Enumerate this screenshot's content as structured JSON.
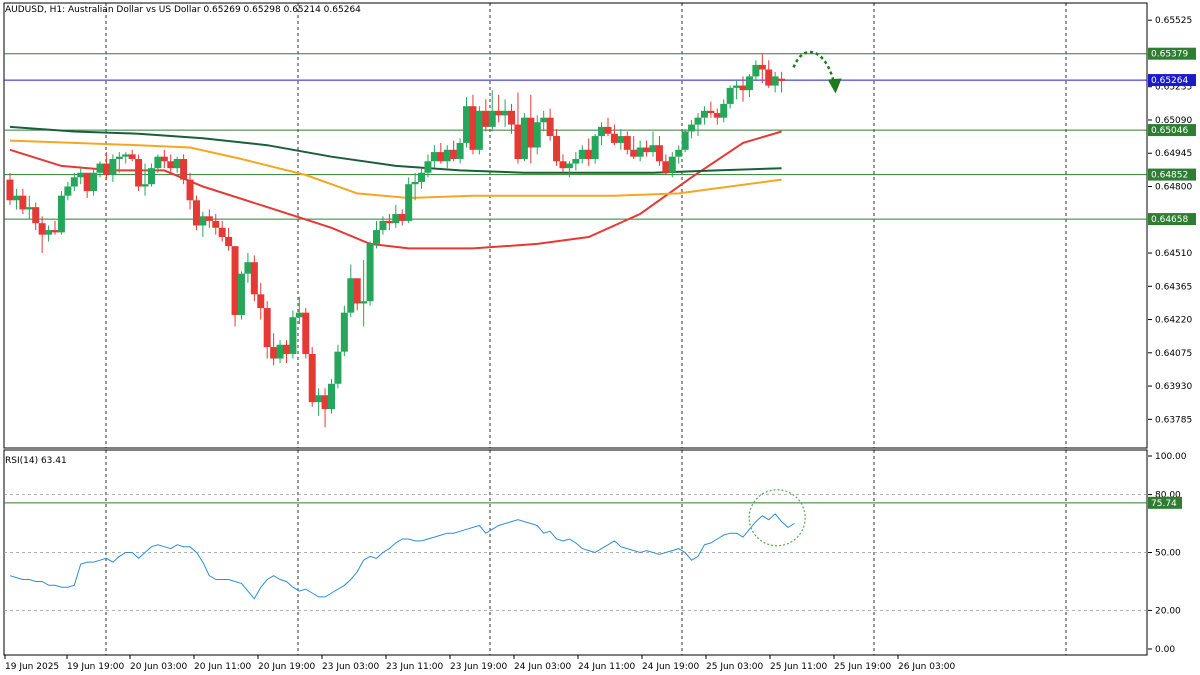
{
  "header": {
    "symbol_line": "AUDUSD, H1:  Australian Dollar vs US Dollar  0.65269 0.65298 0.65214 0.65264"
  },
  "colors": {
    "bull": "#26a65b",
    "bear": "#e53935",
    "ema_fast": "#e53935",
    "ema_mid": "#f5a623",
    "ema_slow": "#1b5e3b",
    "level_line": "#2e7d32",
    "price_line": "#1a1acc",
    "rsi_line": "#2f8fd6",
    "arrow": "#1e7a1e"
  },
  "chart_data": [
    {
      "type": "candlestick",
      "symbol": "AUDUSD",
      "timeframe": "H1",
      "title": "AUDUSD, H1:  Australian Dollar vs US Dollar",
      "last_ohlc": {
        "open": 0.65269,
        "high": 0.65298,
        "low": 0.65214,
        "close": 0.65264
      },
      "ylim": [
        0.6366,
        0.656
      ],
      "y_ticks": [
        "0.65525",
        "0.65235",
        "0.65090",
        "0.64945",
        "0.64800",
        "0.64510",
        "0.64365",
        "0.64220",
        "0.64075",
        "0.63930",
        "0.63785"
      ],
      "x_ticks": [
        "19 Jun 2025",
        "19 Jun 19:00",
        "20 Jun 03:00",
        "20 Jun 11:00",
        "20 Jun 19:00",
        "23 Jun 03:00",
        "23 Jun 11:00",
        "23 Jun 19:00",
        "24 Jun 03:00",
        "24 Jun 11:00",
        "24 Jun 19:00",
        "25 Jun 03:00",
        "25 Jun 11:00",
        "25 Jun 19:00",
        "26 Jun 03:00"
      ],
      "candles": [
        [
          0.6483,
          0.6486,
          0.6472,
          0.6474
        ],
        [
          0.6474,
          0.6479,
          0.647,
          0.6476
        ],
        [
          0.6476,
          0.6479,
          0.6468,
          0.647
        ],
        [
          0.647,
          0.6476,
          0.6466,
          0.6471
        ],
        [
          0.6471,
          0.6473,
          0.6461,
          0.6464
        ],
        [
          0.6464,
          0.6467,
          0.6451,
          0.6459
        ],
        [
          0.6459,
          0.6463,
          0.6456,
          0.6461
        ],
        [
          0.6461,
          0.6465,
          0.6459,
          0.646
        ],
        [
          0.646,
          0.6478,
          0.6459,
          0.6476
        ],
        [
          0.6476,
          0.6482,
          0.6474,
          0.648
        ],
        [
          0.648,
          0.6486,
          0.6478,
          0.6484
        ],
        [
          0.6484,
          0.6488,
          0.6481,
          0.6486
        ],
        [
          0.6486,
          0.6484,
          0.6475,
          0.6478
        ],
        [
          0.6478,
          0.6488,
          0.6476,
          0.6486
        ],
        [
          0.6486,
          0.6491,
          0.6484,
          0.649
        ],
        [
          0.649,
          0.6495,
          0.6483,
          0.6485
        ],
        [
          0.6485,
          0.6494,
          0.6482,
          0.6492
        ],
        [
          0.6492,
          0.6495,
          0.6486,
          0.6493
        ],
        [
          0.6493,
          0.6495,
          0.649,
          0.6494
        ],
        [
          0.6494,
          0.6496,
          0.6491,
          0.6492
        ],
        [
          0.6492,
          0.6494,
          0.6478,
          0.648
        ],
        [
          0.648,
          0.649,
          0.6476,
          0.6481
        ],
        [
          0.6481,
          0.649,
          0.648,
          0.6488
        ],
        [
          0.6488,
          0.6494,
          0.6486,
          0.6493
        ],
        [
          0.6493,
          0.6496,
          0.6488,
          0.6491
        ],
        [
          0.6491,
          0.6494,
          0.6486,
          0.6488
        ],
        [
          0.6488,
          0.6493,
          0.6486,
          0.6492
        ],
        [
          0.6492,
          0.6494,
          0.6481,
          0.6483
        ],
        [
          0.6483,
          0.6486,
          0.647,
          0.6474
        ],
        [
          0.6474,
          0.6476,
          0.6461,
          0.6463
        ],
        [
          0.6463,
          0.6469,
          0.6458,
          0.6467
        ],
        [
          0.6467,
          0.647,
          0.6462,
          0.6465
        ],
        [
          0.6465,
          0.6468,
          0.6459,
          0.6462
        ],
        [
          0.6462,
          0.6465,
          0.6456,
          0.6458
        ],
        [
          0.6458,
          0.6462,
          0.6452,
          0.6454
        ],
        [
          0.6454,
          0.6448,
          0.6419,
          0.6424
        ],
        [
          0.6424,
          0.6443,
          0.6422,
          0.6442
        ],
        [
          0.6442,
          0.6451,
          0.6438,
          0.6447
        ],
        [
          0.6447,
          0.645,
          0.643,
          0.6433
        ],
        [
          0.6433,
          0.6438,
          0.6422,
          0.6427
        ],
        [
          0.6427,
          0.643,
          0.6405,
          0.641
        ],
        [
          0.641,
          0.6416,
          0.6402,
          0.6405
        ],
        [
          0.6405,
          0.6413,
          0.6403,
          0.6411
        ],
        [
          0.6411,
          0.6413,
          0.6403,
          0.6407
        ],
        [
          0.6407,
          0.6426,
          0.6405,
          0.6423
        ],
        [
          0.6423,
          0.6432,
          0.642,
          0.6425
        ],
        [
          0.6425,
          0.6427,
          0.6405,
          0.6407
        ],
        [
          0.6407,
          0.641,
          0.6384,
          0.6386
        ],
        [
          0.6386,
          0.6392,
          0.638,
          0.6389
        ],
        [
          0.6389,
          0.6392,
          0.6375,
          0.6383
        ],
        [
          0.6383,
          0.6396,
          0.6381,
          0.6394
        ],
        [
          0.6394,
          0.6411,
          0.6392,
          0.6408
        ],
        [
          0.6408,
          0.6428,
          0.6406,
          0.6425
        ],
        [
          0.6425,
          0.6446,
          0.6423,
          0.644
        ],
        [
          0.644,
          0.6437,
          0.6426,
          0.6429
        ],
        [
          0.6429,
          0.6448,
          0.6419,
          0.643
        ],
        [
          0.643,
          0.6456,
          0.6428,
          0.6455
        ],
        [
          0.6455,
          0.6465,
          0.6453,
          0.6461
        ],
        [
          0.6461,
          0.6467,
          0.6459,
          0.6465
        ],
        [
          0.6465,
          0.6468,
          0.6461,
          0.6464
        ],
        [
          0.6464,
          0.6472,
          0.6462,
          0.6468
        ],
        [
          0.6468,
          0.647,
          0.6463,
          0.6465
        ],
        [
          0.6465,
          0.6484,
          0.6464,
          0.6481
        ],
        [
          0.6481,
          0.6486,
          0.6474,
          0.6482
        ],
        [
          0.6482,
          0.6488,
          0.6479,
          0.6486
        ],
        [
          0.6486,
          0.6494,
          0.6484,
          0.6491
        ],
        [
          0.6491,
          0.6498,
          0.6488,
          0.6495
        ],
        [
          0.6495,
          0.6499,
          0.649,
          0.6491
        ],
        [
          0.6491,
          0.6498,
          0.6488,
          0.6496
        ],
        [
          0.6496,
          0.65,
          0.6491,
          0.6492
        ],
        [
          0.6492,
          0.6501,
          0.649,
          0.6499
        ],
        [
          0.6499,
          0.6519,
          0.6497,
          0.6515
        ],
        [
          0.6515,
          0.652,
          0.6494,
          0.6496
        ],
        [
          0.6496,
          0.6515,
          0.6494,
          0.6513
        ],
        [
          0.6513,
          0.6518,
          0.6504,
          0.6506
        ],
        [
          0.6506,
          0.6522,
          0.6504,
          0.6513
        ],
        [
          0.6513,
          0.652,
          0.6508,
          0.6511
        ],
        [
          0.6511,
          0.6518,
          0.6506,
          0.6513
        ],
        [
          0.6513,
          0.6516,
          0.6503,
          0.6507
        ],
        [
          0.6507,
          0.6521,
          0.649,
          0.6492
        ],
        [
          0.6492,
          0.6512,
          0.6491,
          0.651
        ],
        [
          0.651,
          0.652,
          0.649,
          0.6497
        ],
        [
          0.6497,
          0.6511,
          0.6494,
          0.6508
        ],
        [
          0.6508,
          0.6513,
          0.6504,
          0.651
        ],
        [
          0.651,
          0.6514,
          0.65,
          0.6502
        ],
        [
          0.6502,
          0.6505,
          0.6489,
          0.6491
        ],
        [
          0.6491,
          0.6494,
          0.6486,
          0.6488
        ],
        [
          0.6488,
          0.6491,
          0.6484,
          0.649
        ],
        [
          0.649,
          0.6495,
          0.6487,
          0.6492
        ],
        [
          0.6492,
          0.6498,
          0.649,
          0.6496
        ],
        [
          0.6496,
          0.6501,
          0.6489,
          0.6492
        ],
        [
          0.6492,
          0.6503,
          0.649,
          0.6502
        ],
        [
          0.6502,
          0.6508,
          0.6498,
          0.6506
        ],
        [
          0.6506,
          0.651,
          0.6502,
          0.6503
        ],
        [
          0.6503,
          0.6507,
          0.6498,
          0.6499
        ],
        [
          0.6499,
          0.6505,
          0.6496,
          0.6502
        ],
        [
          0.6502,
          0.6504,
          0.6494,
          0.6496
        ],
        [
          0.6496,
          0.6502,
          0.6492,
          0.6493
        ],
        [
          0.6493,
          0.65,
          0.6491,
          0.6497
        ],
        [
          0.6497,
          0.65,
          0.6493,
          0.6495
        ],
        [
          0.6495,
          0.6504,
          0.6493,
          0.6498
        ],
        [
          0.6498,
          0.6502,
          0.6489,
          0.6491
        ],
        [
          0.6491,
          0.6494,
          0.6485,
          0.6486
        ],
        [
          0.6486,
          0.6495,
          0.6484,
          0.6493
        ],
        [
          0.6493,
          0.6498,
          0.649,
          0.6496
        ],
        [
          0.6496,
          0.6505,
          0.6495,
          0.6504
        ],
        [
          0.6504,
          0.6509,
          0.6501,
          0.6507
        ],
        [
          0.6507,
          0.6512,
          0.6502,
          0.651
        ],
        [
          0.651,
          0.6515,
          0.6507,
          0.6513
        ],
        [
          0.6513,
          0.6517,
          0.651,
          0.6512
        ],
        [
          0.6512,
          0.6514,
          0.6507,
          0.651
        ],
        [
          0.651,
          0.6518,
          0.6508,
          0.6516
        ],
        [
          0.6516,
          0.6524,
          0.6514,
          0.6523
        ],
        [
          0.6523,
          0.6526,
          0.6518,
          0.6524
        ],
        [
          0.6524,
          0.6528,
          0.6517,
          0.6522
        ],
        [
          0.6522,
          0.6529,
          0.6519,
          0.6528
        ],
        [
          0.6528,
          0.6535,
          0.6526,
          0.6533
        ],
        [
          0.6533,
          0.6538,
          0.6525,
          0.6531
        ],
        [
          0.6531,
          0.6535,
          0.6523,
          0.6524
        ],
        [
          0.6524,
          0.653,
          0.6521,
          0.6528
        ],
        [
          0.6527,
          0.653,
          0.6521,
          0.6526
        ]
      ],
      "moving_averages": [
        {
          "color_key": "ema_fast",
          "values": [
            [
              0,
              0.6496
            ],
            [
              8,
              0.6489
            ],
            [
              16,
              0.6487
            ],
            [
              24,
              0.6487
            ],
            [
              30,
              0.648
            ],
            [
              40,
              0.6471
            ],
            [
              50,
              0.6462
            ],
            [
              56,
              0.6455
            ],
            [
              62,
              0.6453
            ],
            [
              72,
              0.6453
            ],
            [
              82,
              0.6455
            ],
            [
              90,
              0.6458
            ],
            [
              98,
              0.6468
            ],
            [
              106,
              0.6484
            ],
            [
              114,
              0.6499
            ],
            [
              120,
              0.6504
            ]
          ]
        },
        {
          "color_key": "ema_mid",
          "values": [
            [
              0,
              0.65
            ],
            [
              10,
              0.6499
            ],
            [
              20,
              0.6498
            ],
            [
              28,
              0.6497
            ],
            [
              36,
              0.6492
            ],
            [
              46,
              0.6485
            ],
            [
              54,
              0.6477
            ],
            [
              62,
              0.6475
            ],
            [
              72,
              0.6476
            ],
            [
              84,
              0.6476
            ],
            [
              94,
              0.6476
            ],
            [
              104,
              0.6477
            ],
            [
              112,
              0.648
            ],
            [
              120,
              0.6483
            ]
          ]
        },
        {
          "color_key": "ema_slow",
          "values": [
            [
              0,
              0.6506
            ],
            [
              10,
              0.6504
            ],
            [
              20,
              0.6503
            ],
            [
              30,
              0.6501
            ],
            [
              40,
              0.6498
            ],
            [
              50,
              0.6493
            ],
            [
              60,
              0.6489
            ],
            [
              70,
              0.6487
            ],
            [
              80,
              0.6486
            ],
            [
              90,
              0.6486
            ],
            [
              100,
              0.6486
            ],
            [
              110,
              0.6487
            ],
            [
              120,
              0.6488
            ]
          ]
        }
      ],
      "horizontal_levels": [
        {
          "label": "0.65379",
          "price": 0.65379,
          "color_key": "level_line"
        },
        {
          "label": "0.65264",
          "price": 0.65264,
          "color_key": "price_line"
        },
        {
          "label": "0.65046",
          "price": 0.65046,
          "color_key": "level_line"
        },
        {
          "label": "0.64852",
          "price": 0.64852,
          "color_key": "level_line"
        },
        {
          "label": "0.64658",
          "price": 0.64658,
          "color_key": "level_line"
        }
      ]
    },
    {
      "type": "line",
      "title": "RSI(14) 63.41",
      "ylim": [
        0,
        100
      ],
      "y_ticks": [
        "100.00",
        "80.00",
        "50.00",
        "20.00",
        "0.00"
      ],
      "levels": [
        80,
        50,
        20
      ],
      "marker_label": "75.74",
      "marker_value": 75.74,
      "values": [
        38,
        37,
        36,
        36,
        35,
        35,
        33,
        33,
        32,
        32,
        33,
        44,
        45,
        45,
        46,
        47,
        45,
        48,
        50,
        50,
        47,
        50,
        53,
        54,
        53,
        52,
        54,
        53,
        53,
        50,
        45,
        38,
        36,
        36,
        36,
        35,
        34,
        30,
        26,
        32,
        36,
        38,
        36,
        35,
        32,
        30,
        31,
        29,
        27,
        27,
        29,
        31,
        33,
        36,
        40,
        46,
        48,
        47,
        50,
        52,
        55,
        57,
        57,
        56,
        56,
        57,
        58,
        59,
        60,
        60,
        61,
        62,
        63,
        64,
        60,
        62,
        64,
        65,
        66,
        67,
        66,
        65,
        64,
        60,
        61,
        57,
        56,
        57,
        55,
        52,
        51,
        50,
        52,
        54,
        56,
        53,
        52,
        51,
        50,
        51,
        50,
        49,
        50,
        51,
        52,
        50,
        46,
        48,
        54,
        55,
        57,
        59,
        60,
        60,
        58,
        62,
        66,
        69,
        67,
        70,
        66,
        63,
        65
      ]
    }
  ]
}
